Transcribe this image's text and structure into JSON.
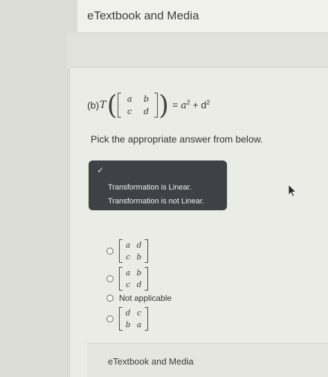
{
  "header": {
    "title": "eTextbook and Media"
  },
  "question": {
    "label": "(b)",
    "func": "T",
    "matrix": [
      "a",
      "b",
      "c",
      "d"
    ],
    "equals": "=",
    "rhs_a": "a",
    "exp1": "2",
    "plus": "+",
    "rhs_d": "d",
    "exp2": "2"
  },
  "prompt": "Pick the appropriate answer from below.",
  "dropdown": {
    "check_mark": "✓",
    "options": [
      "Transformation is Linear.",
      "Transformation is not Linear."
    ]
  },
  "answers": {
    "option1": [
      "a",
      "d",
      "c",
      "b"
    ],
    "option2": [
      "a",
      "b",
      "c",
      "d"
    ],
    "option3_label": "Not applicable",
    "option4": [
      "d",
      "c",
      "b",
      "a"
    ]
  },
  "footer": {
    "title": "eTextbook and Media"
  }
}
